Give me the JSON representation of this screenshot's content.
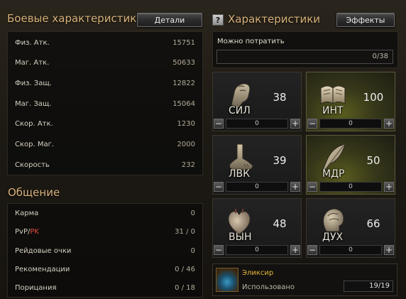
{
  "combat": {
    "title": "Боевые характеристики",
    "details_label": "Детали",
    "stats": [
      {
        "label": "Физ. Атк.",
        "value": "15751"
      },
      {
        "label": "Маг. Атк.",
        "value": "50633"
      },
      {
        "label": "Физ. Защ.",
        "value": "12822"
      },
      {
        "label": "Маг. Защ.",
        "value": "15064"
      },
      {
        "label": "Скор. Атк.",
        "value": "1230"
      },
      {
        "label": "Скор. Маг.",
        "value": "2000"
      },
      {
        "label": "Скорость",
        "value": "232"
      }
    ]
  },
  "social": {
    "title": "Общение",
    "rows": [
      {
        "label": "Карма",
        "value": "0"
      },
      {
        "label_a": "PvP/",
        "label_b": "PK",
        "value": "31 / 0"
      },
      {
        "label": "Рейдовые очки",
        "value": "0"
      },
      {
        "label": "Рекомендации",
        "value": "0 / 46"
      },
      {
        "label": "Порицания",
        "value": "0 / 18"
      }
    ]
  },
  "characteristics": {
    "help_glyph": "?",
    "title": "Характеристики",
    "effects_label": "Эффекты",
    "spend_label": "Можно потратить",
    "spend_value": "0/38",
    "cards": [
      {
        "abbr": "СИЛ",
        "value": "38",
        "added": "0",
        "icon": "fist-icon"
      },
      {
        "abbr": "ИНТ",
        "value": "100",
        "added": "0",
        "icon": "book-icon"
      },
      {
        "abbr": "ЛВК",
        "value": "39",
        "added": "0",
        "icon": "foot-icon"
      },
      {
        "abbr": "МДР",
        "value": "50",
        "added": "0",
        "icon": "feather-icon"
      },
      {
        "abbr": "ВЫН",
        "value": "48",
        "added": "0",
        "icon": "heart-icon"
      },
      {
        "abbr": "ДУХ",
        "value": "66",
        "added": "0",
        "icon": "head-icon"
      }
    ],
    "minus_glyph": "−",
    "plus_glyph": "+"
  },
  "elixir": {
    "title": "Эликсир",
    "used_label": "Использовано",
    "used_value": "19/19"
  }
}
